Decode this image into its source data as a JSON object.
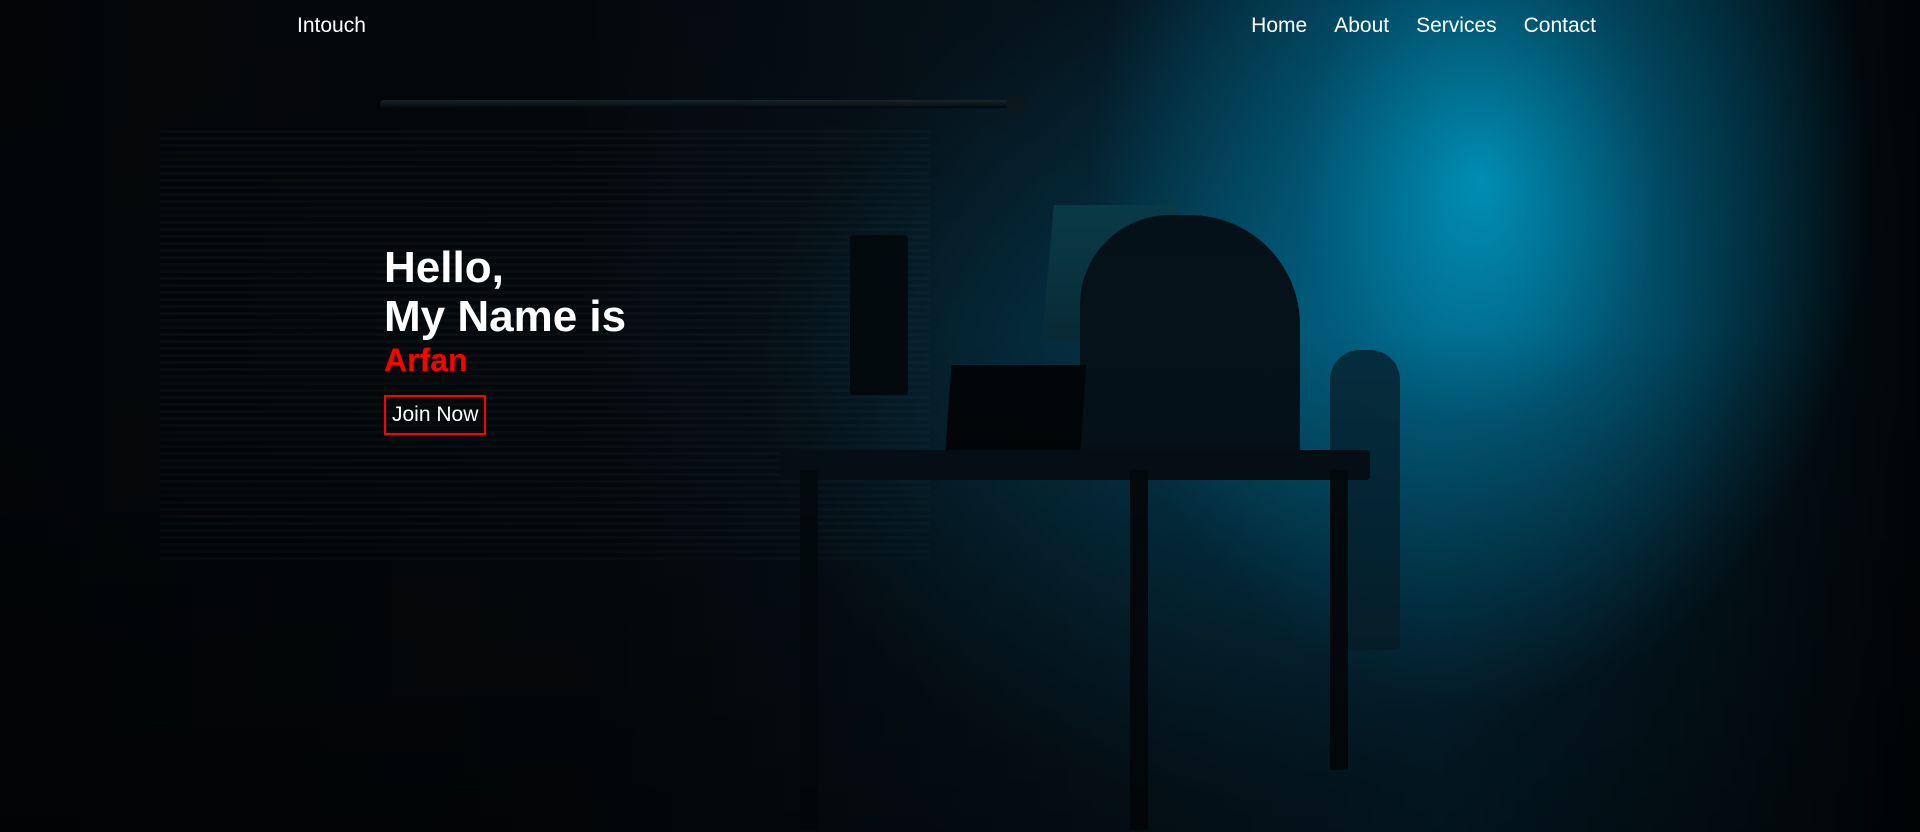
{
  "nav": {
    "logo": "Intouch",
    "links": [
      "Home",
      "About",
      "Services",
      "Contact"
    ]
  },
  "hero": {
    "greeting": "Hello,",
    "intro": "My Name is",
    "name": "Arfan",
    "cta_label": "Join Now"
  },
  "colors": {
    "accent": "#ff0000",
    "text": "#ffffff",
    "background": "#05090c",
    "glow": "#00aad7"
  }
}
